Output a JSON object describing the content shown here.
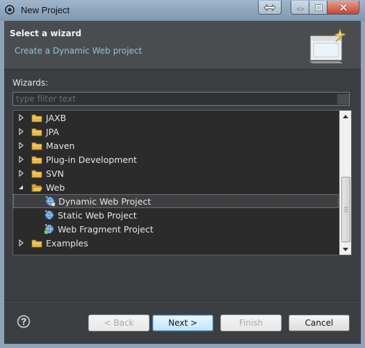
{
  "window": {
    "title": "New Project"
  },
  "header": {
    "title": "Select a wizard",
    "subtitle": "Create a Dynamic Web project"
  },
  "wizards": {
    "label": "Wizards:",
    "filter_placeholder": "type filter text",
    "filter_value": ""
  },
  "tree": {
    "items": [
      {
        "label": "JAXB",
        "kind": "folder",
        "expanded": false
      },
      {
        "label": "JPA",
        "kind": "folder",
        "expanded": false
      },
      {
        "label": "Maven",
        "kind": "folder",
        "expanded": false
      },
      {
        "label": "Plug-in Development",
        "kind": "folder",
        "expanded": false
      },
      {
        "label": "SVN",
        "kind": "folder",
        "expanded": false
      },
      {
        "label": "Web",
        "kind": "folder",
        "expanded": true
      },
      {
        "label": "Dynamic Web Project",
        "kind": "wizard",
        "selected": true
      },
      {
        "label": "Static Web Project",
        "kind": "wizard"
      },
      {
        "label": "Web Fragment Project",
        "kind": "wizard"
      },
      {
        "label": "Examples",
        "kind": "folder",
        "expanded": false
      }
    ]
  },
  "buttons": {
    "back": "< Back",
    "next": "Next >",
    "finish": "Finish",
    "cancel": "Cancel"
  },
  "colors": {
    "background": "#3c3f41",
    "subtitle": "#8fc3e0",
    "folder": "#e8b84a"
  }
}
